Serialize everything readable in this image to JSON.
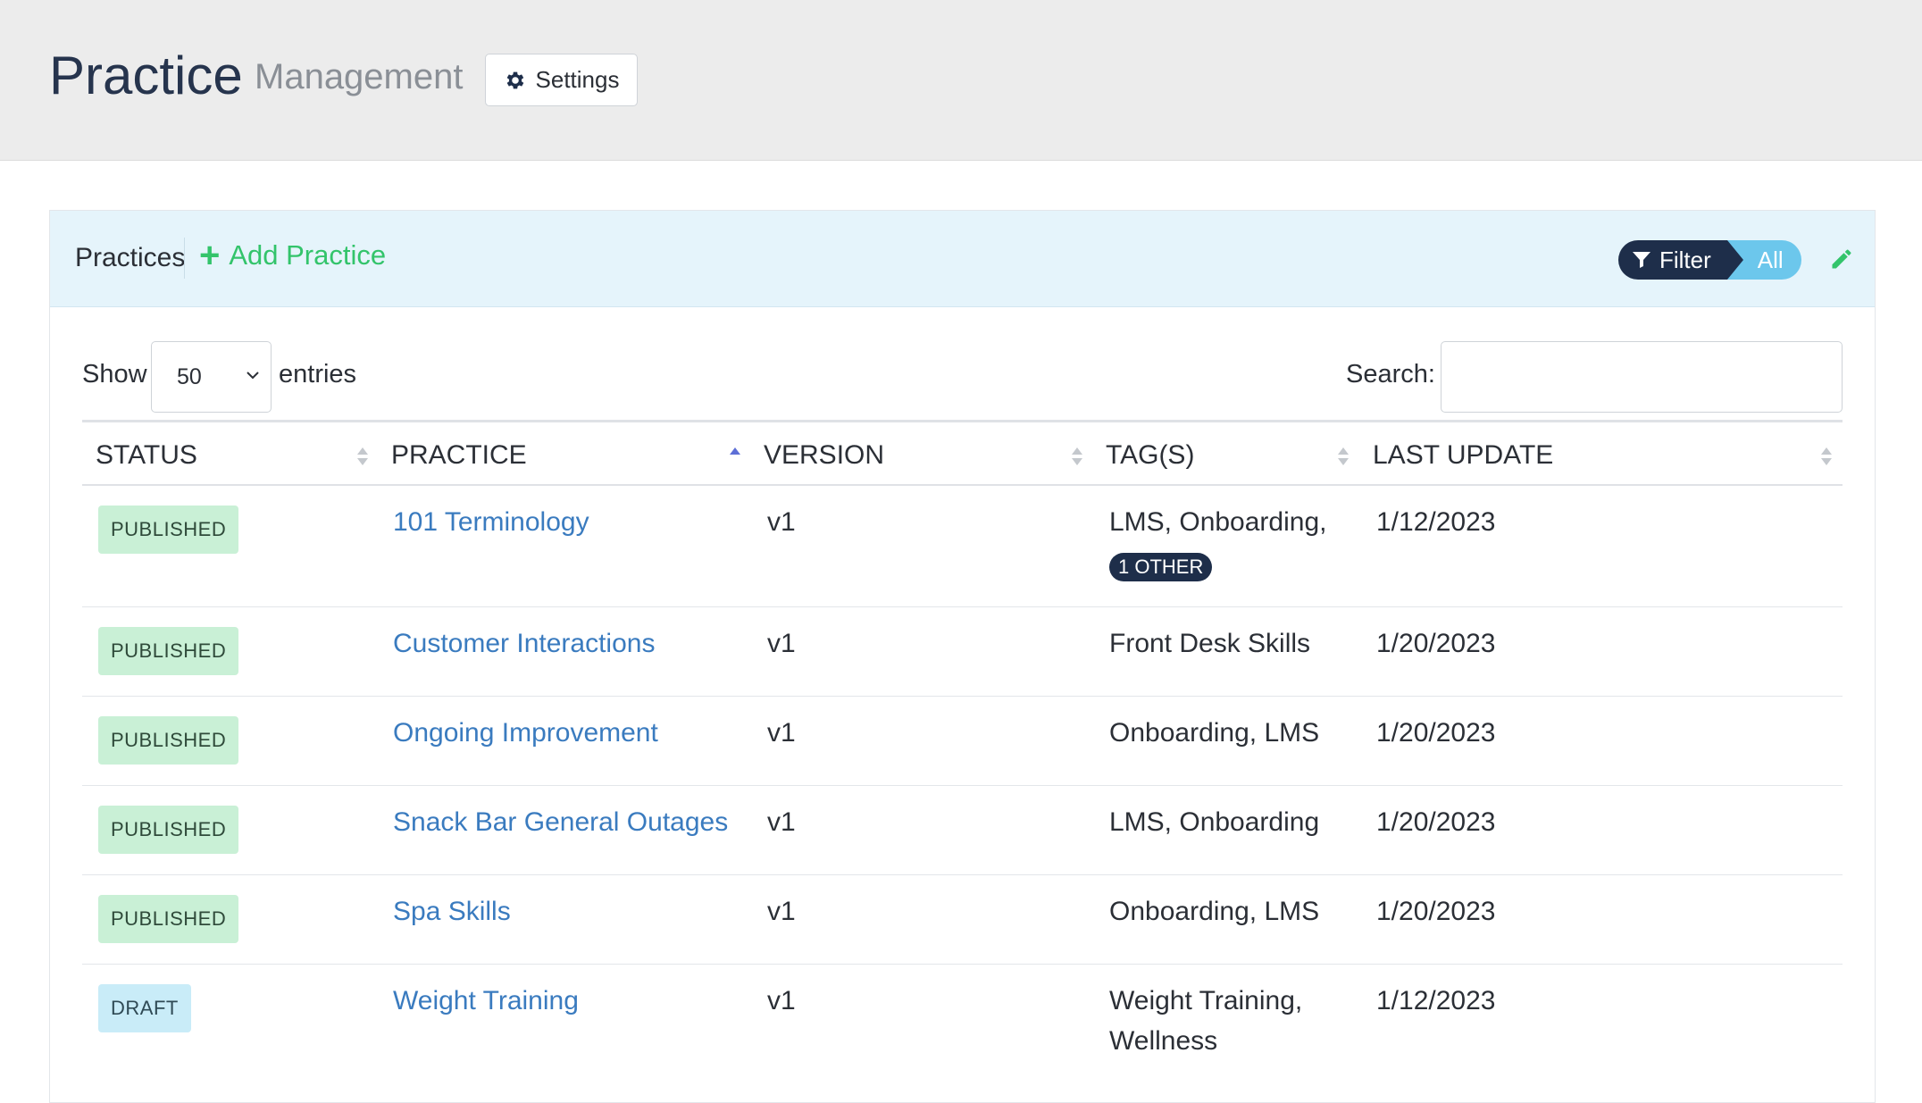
{
  "header": {
    "title": "Practice",
    "subtitle": "Management",
    "settings_label": "Settings"
  },
  "panel": {
    "title": "Practices",
    "add_label": "Add Practice",
    "filter_label": "Filter",
    "filter_value": "All"
  },
  "controls": {
    "show_label": "Show",
    "entries_value": "50",
    "entries_label": "entries",
    "search_label": "Search:",
    "search_value": ""
  },
  "table": {
    "columns": [
      "STATUS",
      "PRACTICE",
      "VERSION",
      "TAG(S)",
      "LAST UPDATE"
    ],
    "rows": [
      {
        "status": "PUBLISHED",
        "status_type": "published",
        "practice": "101 Terminology",
        "version": "v1",
        "tags": "LMS, Onboarding,",
        "tags_line2": "",
        "tag_extra": "1 OTHER",
        "updated": "1/12/2023"
      },
      {
        "status": "PUBLISHED",
        "status_type": "published",
        "practice": "Customer Interactions",
        "version": "v1",
        "tags": "Front Desk Skills",
        "tags_line2": "",
        "tag_extra": "",
        "updated": "1/20/2023"
      },
      {
        "status": "PUBLISHED",
        "status_type": "published",
        "practice": "Ongoing Improvement",
        "version": "v1",
        "tags": "Onboarding, LMS",
        "tags_line2": "",
        "tag_extra": "",
        "updated": "1/20/2023"
      },
      {
        "status": "PUBLISHED",
        "status_type": "published",
        "practice": "Snack Bar General Outages",
        "version": "v1",
        "tags": "LMS, Onboarding",
        "tags_line2": "",
        "tag_extra": "",
        "updated": "1/20/2023"
      },
      {
        "status": "PUBLISHED",
        "status_type": "published",
        "practice": "Spa Skills",
        "version": "v1",
        "tags": "Onboarding, LMS",
        "tags_line2": "",
        "tag_extra": "",
        "updated": "1/20/2023"
      },
      {
        "status": "DRAFT",
        "status_type": "draft",
        "practice": "Weight Training",
        "version": "v1",
        "tags": "Weight Training,",
        "tags_line2": "Wellness",
        "tag_extra": "",
        "updated": "1/12/2023"
      }
    ]
  },
  "colors": {
    "accent_green": "#33c46b",
    "link_blue": "#3a7bbf",
    "navy": "#1e2e4a",
    "panel_head_bg": "#e5f4fb"
  }
}
